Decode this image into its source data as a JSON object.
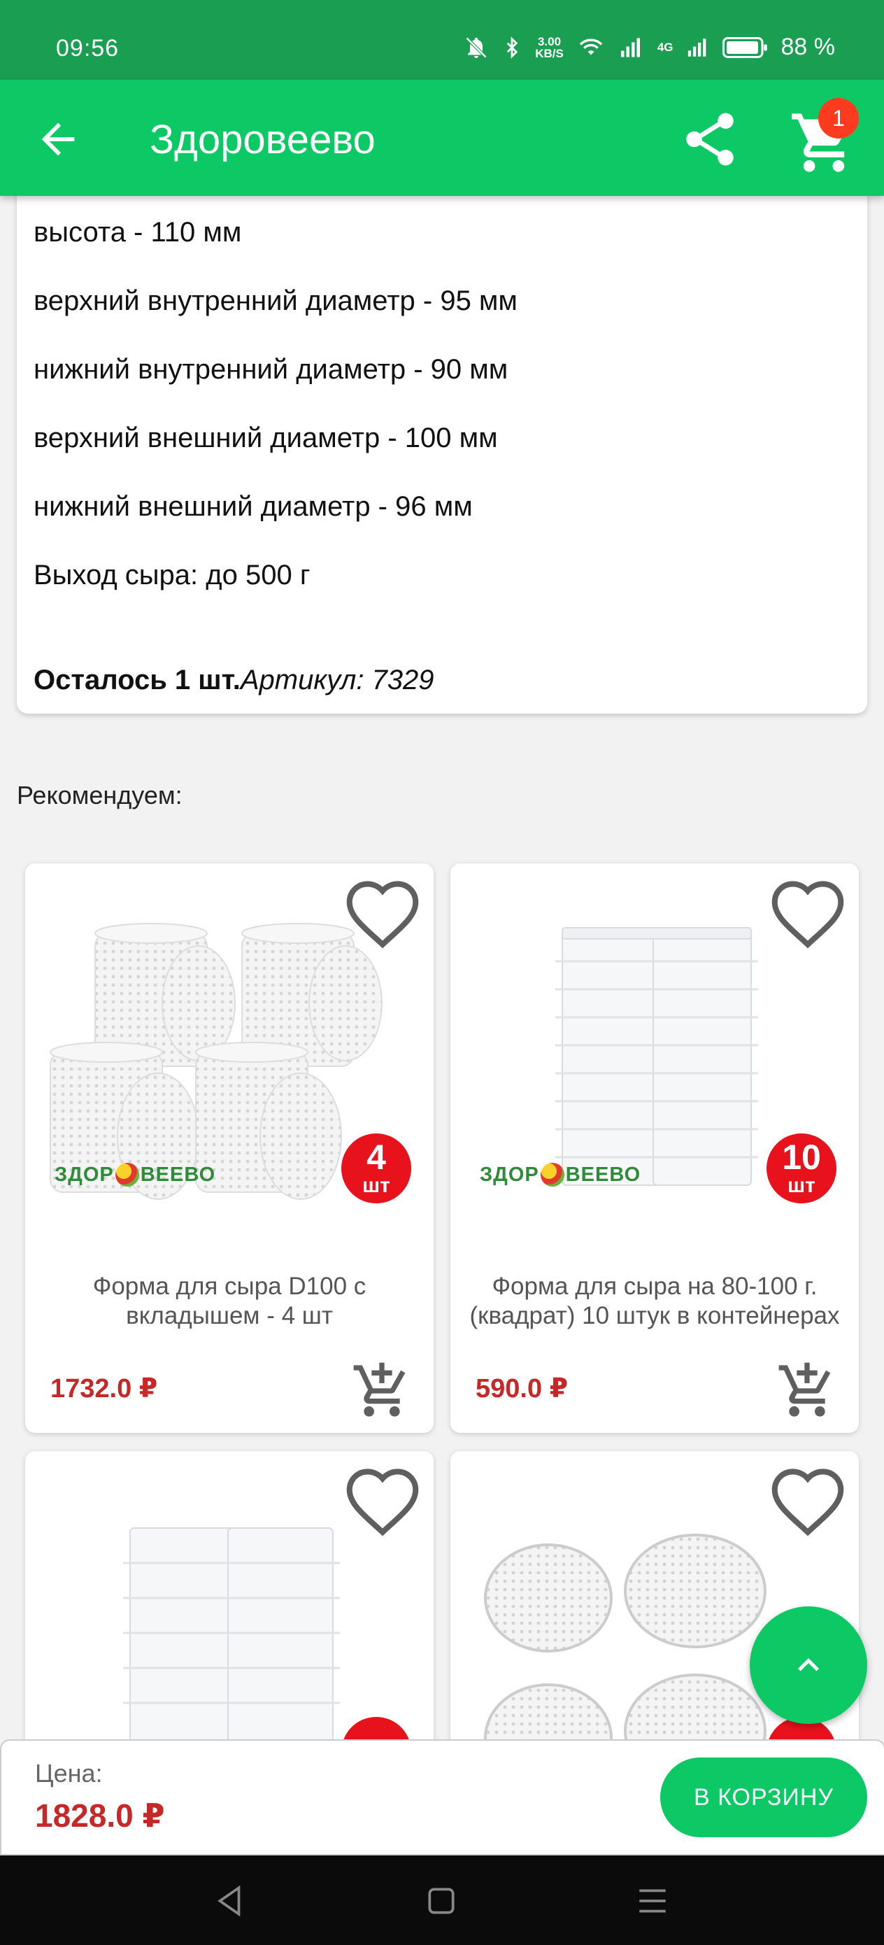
{
  "status_bar": {
    "time": "09:56",
    "speed_value": "3.00",
    "speed_unit": "KB/S",
    "network_label": "4G",
    "battery_percent": "88 %"
  },
  "app_bar": {
    "title": "Здоровеево",
    "cart_count": "1"
  },
  "description": {
    "lines": [
      "высота - 110 мм",
      "верхний внутренний диаметр - 95 мм",
      "нижний внутренний диаметр - 90 мм",
      "верхний внешний диаметр - 100 мм",
      "нижний внешний диаметр - 96 мм",
      "Выход сыра: до 500 г"
    ],
    "stock": "Осталось 1 шт.",
    "sku": "Артикул: 7329"
  },
  "recommend": {
    "title": "Рекомендуем:",
    "products": [
      {
        "name": "Форма для сыра D100 с вкладышем - 4 шт",
        "price": "1732.0 ₽",
        "badge_count": "4",
        "badge_unit": "шт",
        "brand_left": "ЗДОР",
        "brand_right": "ВЕЕВО"
      },
      {
        "name": "Форма для сыра на 80-100 г. (квадрат) 10 штук в контейнерах",
        "price": "590.0 ₽",
        "badge_count": "10",
        "badge_unit": "шт",
        "brand_left": "ЗДОР",
        "brand_right": "ВЕЕВО"
      }
    ]
  },
  "buy_bar": {
    "price_label": "Цена:",
    "price_value": "1828.0 ₽",
    "button_label": "В КОРЗИНУ"
  },
  "colors": {
    "status_bar": "#1a9f52",
    "app_bar": "#0dc965",
    "price": "#c62828",
    "badge": "#e8121c"
  },
  "icons": {
    "back": "arrow-back-icon",
    "share": "share-icon",
    "cart": "cart-icon",
    "favorite": "heart-outline-icon",
    "add_to_cart": "add-shopping-cart-icon",
    "scroll_top": "chevron-up-icon"
  }
}
